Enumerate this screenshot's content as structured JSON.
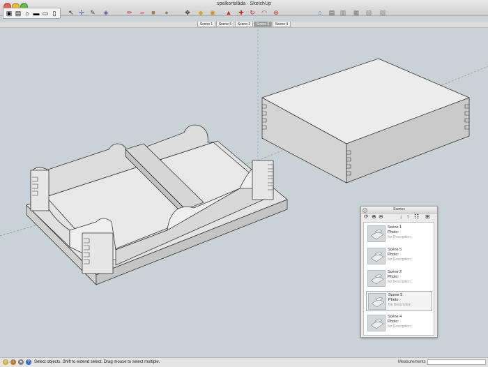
{
  "window": {
    "title": "spelkortslåda - SketchUp"
  },
  "toolbar": {
    "tools": [
      {
        "name": "select-icon",
        "glyph": "↖",
        "color": "#222"
      },
      {
        "name": "orbit-icon",
        "glyph": "✢",
        "color": "#3a58b0"
      },
      {
        "name": "lasso-icon",
        "glyph": "✎",
        "color": "#444"
      },
      {
        "name": "component-icon",
        "glyph": "◈",
        "color": "#5a4e9a"
      },
      {
        "name": "pencil-icon",
        "glyph": "✏",
        "color": "#c0282d"
      },
      {
        "name": "eraser-icon",
        "glyph": "▰",
        "color": "#e58aa3"
      },
      {
        "name": "rectangle-icon",
        "glyph": "■",
        "color": "#9a7b52"
      },
      {
        "name": "circle-icon",
        "glyph": "●",
        "color": "#9a8256"
      },
      {
        "name": "move-icon",
        "glyph": "✥",
        "color": "#333"
      },
      {
        "name": "paint-bucket-icon",
        "glyph": "◆",
        "color": "#d7a722"
      },
      {
        "name": "tape-measure-icon",
        "glyph": "◉",
        "color": "#c78a1c"
      },
      {
        "name": "push-pull-icon",
        "glyph": "▲",
        "color": "#c0282d"
      },
      {
        "name": "follow-me-icon",
        "glyph": "✚",
        "color": "#c0282d"
      },
      {
        "name": "rotate-icon",
        "glyph": "↻",
        "color": "#c0282d"
      },
      {
        "name": "offset-icon",
        "glyph": "◠",
        "color": "#c0282d"
      },
      {
        "name": "scale-icon",
        "glyph": "⊛",
        "color": "#c0282d"
      },
      {
        "name": "warehouse-icon",
        "glyph": "⌂",
        "color": "#3b73b9"
      },
      {
        "name": "component-window-icon",
        "glyph": "▤",
        "color": "#555"
      },
      {
        "name": "share-model-icon",
        "glyph": "▥",
        "color": "#777"
      },
      {
        "name": "share-component-icon",
        "glyph": "▦",
        "color": "#777"
      },
      {
        "name": "extension-warehouse-icon",
        "glyph": "▧",
        "color": "#888"
      },
      {
        "name": "layout-icon",
        "glyph": "▨",
        "color": "#888"
      }
    ]
  },
  "tabs": [
    {
      "label": "Scene 1",
      "active": false
    },
    {
      "label": "Scene 5",
      "active": false
    },
    {
      "label": "Scene 2",
      "active": false
    },
    {
      "label": "Scene 3",
      "active": true
    },
    {
      "label": "Scene 4",
      "active": false
    }
  ],
  "scenes_panel": {
    "title": "Scenes",
    "items": [
      {
        "name": "Scene 1",
        "photo": "Photo:",
        "desc": "No Description",
        "selected": false
      },
      {
        "name": "Scene 5",
        "photo": "Photo:",
        "desc": "No Description",
        "selected": false
      },
      {
        "name": "Scene 2",
        "photo": "Photo:",
        "desc": "No Description",
        "selected": false
      },
      {
        "name": "Scene 3",
        "photo": "Photo:",
        "desc": "No Description",
        "selected": true
      },
      {
        "name": "Scene 4",
        "photo": "Photo:",
        "desc": "No Description",
        "selected": false
      }
    ]
  },
  "statusbar": {
    "text": "Select objects. Shift to extend select. Drag mouse to select multiple.",
    "measurements_label": "Measurements"
  },
  "colors": {
    "viewport_bg": "#c9d2d6",
    "model_face": "#ececec",
    "model_side": "#c9c9c9",
    "traffic_close": "#ec5f57",
    "traffic_min": "#e6c12f",
    "traffic_max": "#5fbf41"
  }
}
